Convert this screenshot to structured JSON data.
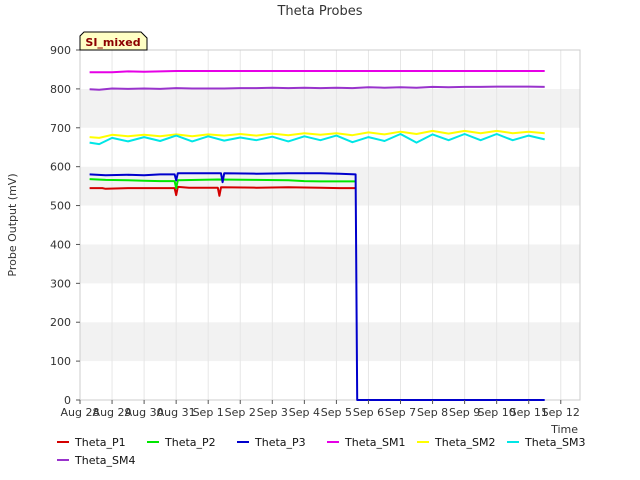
{
  "chart_data": {
    "type": "line",
    "title": "Theta Probes",
    "xlabel": "Time",
    "ylabel": "Probe Output (mV)",
    "site_label": "SI_mixed",
    "ylim": [
      0,
      900
    ],
    "yticks": [
      0,
      100,
      200,
      300,
      400,
      500,
      600,
      700,
      800,
      900
    ],
    "xlim": [
      0,
      15.6
    ],
    "xticks": [
      {
        "x": 0,
        "label": "Aug 28"
      },
      {
        "x": 1,
        "label": "Aug 29"
      },
      {
        "x": 2,
        "label": "Aug 30"
      },
      {
        "x": 3,
        "label": "Aug 31"
      },
      {
        "x": 4,
        "label": "Sep 1"
      },
      {
        "x": 5,
        "label": "Sep 2"
      },
      {
        "x": 6,
        "label": "Sep 3"
      },
      {
        "x": 7,
        "label": "Sep 4"
      },
      {
        "x": 8,
        "label": "Sep 5"
      },
      {
        "x": 9,
        "label": "Sep 6"
      },
      {
        "x": 10,
        "label": "Sep 7"
      },
      {
        "x": 11,
        "label": "Sep 8"
      },
      {
        "x": 12,
        "label": "Sep 9"
      },
      {
        "x": 13,
        "label": "Sep 10"
      },
      {
        "x": 14,
        "label": "Sep 11"
      },
      {
        "x": 15,
        "label": "Sep 12"
      }
    ],
    "grid": "horizontal bands",
    "legend_position": "bottom",
    "series": [
      {
        "name": "Theta_P1",
        "color": "#d40000",
        "x": [
          0.3,
          0.7,
          0.8,
          1.5,
          2.5,
          2.95,
          3.0,
          3.05,
          3.4,
          4.3,
          4.35,
          4.4,
          5.5,
          6.5,
          7.5,
          8.1,
          8.6
        ],
        "y": [
          545,
          545,
          543,
          545,
          545,
          545,
          527,
          548,
          546,
          546,
          525,
          547,
          546,
          547,
          546,
          545,
          545
        ]
      },
      {
        "name": "Theta_P2",
        "color": "#00e600",
        "x": [
          0.3,
          0.8,
          1.5,
          2.0,
          2.5,
          2.95,
          3.0,
          3.05,
          4.3,
          5.5,
          6.5,
          7.0,
          7.5,
          8.1,
          8.6
        ],
        "y": [
          568,
          566,
          565,
          564,
          563,
          563,
          545,
          565,
          567,
          566,
          565,
          563,
          562,
          562,
          562
        ]
      },
      {
        "name": "Theta_P3",
        "color": "#0000cc",
        "x": [
          0.3,
          0.8,
          1.5,
          2.0,
          2.5,
          2.95,
          3.0,
          3.05,
          4.4,
          4.45,
          4.5,
          5.5,
          6.5,
          7.5,
          8.1,
          8.6,
          8.65,
          8.7,
          14.5
        ],
        "y": [
          580,
          578,
          579,
          578,
          580,
          580,
          565,
          583,
          583,
          560,
          583,
          582,
          583,
          583,
          582,
          580,
          0,
          0,
          0
        ]
      },
      {
        "name": "Theta_SM1",
        "color": "#e600e6",
        "x": [
          0.3,
          1.0,
          1.5,
          2.0,
          3.0,
          14.5
        ],
        "y": [
          843,
          843,
          845,
          844,
          846,
          846
        ]
      },
      {
        "name": "Theta_SM2",
        "color": "#ffff00",
        "x": [
          0.3,
          0.6,
          1.0,
          1.5,
          2.0,
          2.5,
          3.0,
          3.5,
          4.0,
          4.5,
          5.0,
          5.5,
          6.0,
          6.5,
          7.0,
          7.5,
          8.0,
          8.5,
          9.0,
          9.5,
          10.0,
          10.5,
          11.0,
          11.5,
          12.0,
          12.5,
          13.0,
          13.5,
          14.0,
          14.5
        ],
        "y": [
          676,
          674,
          682,
          678,
          682,
          678,
          683,
          678,
          683,
          680,
          684,
          680,
          685,
          681,
          686,
          682,
          686,
          681,
          688,
          683,
          690,
          684,
          692,
          685,
          692,
          686,
          692,
          686,
          690,
          686
        ]
      },
      {
        "name": "Theta_SM3",
        "color": "#00e6e6",
        "x": [
          0.3,
          0.6,
          1.0,
          1.5,
          2.0,
          2.5,
          3.0,
          3.5,
          4.0,
          4.5,
          5.0,
          5.5,
          6.0,
          6.5,
          7.0,
          7.5,
          8.0,
          8.5,
          9.0,
          9.5,
          10.0,
          10.5,
          11.0,
          11.5,
          12.0,
          12.5,
          13.0,
          13.5,
          14.0,
          14.5
        ],
        "y": [
          662,
          658,
          674,
          665,
          676,
          666,
          680,
          665,
          678,
          667,
          675,
          668,
          677,
          665,
          678,
          668,
          680,
          663,
          676,
          666,
          684,
          662,
          683,
          668,
          684,
          668,
          684,
          668,
          680,
          670
        ]
      },
      {
        "name": "Theta_SM4",
        "color": "#9933cc",
        "x": [
          0.3,
          0.6,
          1.0,
          1.5,
          2.0,
          2.5,
          3.0,
          3.5,
          4.0,
          4.5,
          5.0,
          5.5,
          6.0,
          6.5,
          7.0,
          7.5,
          8.0,
          8.5,
          9.0,
          9.5,
          10.0,
          10.5,
          11.0,
          11.5,
          12.0,
          12.5,
          13.0,
          13.5,
          14.0,
          14.5
        ],
        "y": [
          799,
          798,
          801,
          800,
          801,
          800,
          802,
          801,
          801,
          801,
          802,
          802,
          803,
          802,
          803,
          802,
          803,
          802,
          804,
          803,
          804,
          803,
          805,
          804,
          805,
          805,
          806,
          806,
          806,
          805
        ]
      }
    ]
  }
}
